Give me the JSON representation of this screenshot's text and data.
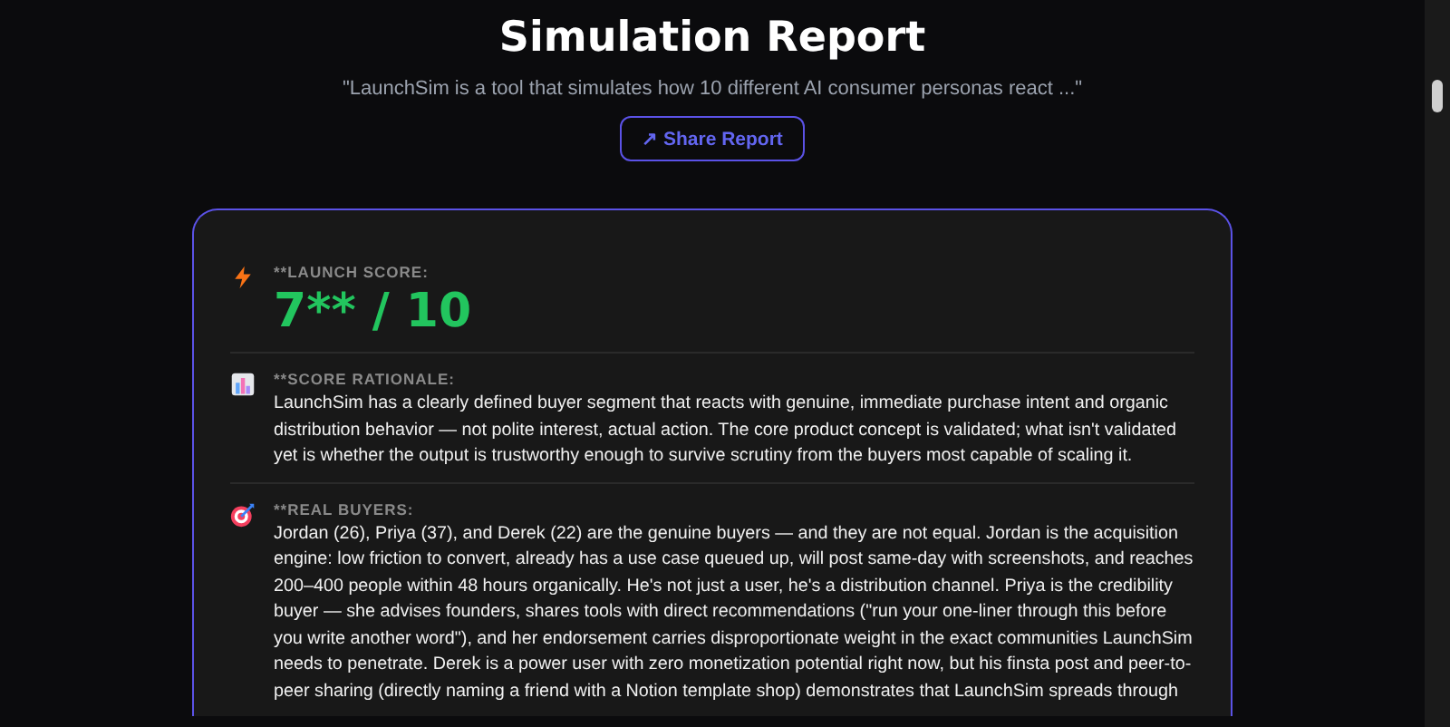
{
  "title": "Simulation Report",
  "summary": "\"LaunchSim is a tool that simulates how 10 different AI consumer personas react ...\"",
  "share_button": {
    "icon": "↗",
    "label": "Share Report"
  },
  "sections": [
    {
      "kind": "score",
      "label": "**LAUNCH SCORE:",
      "value": "7** / 10"
    },
    {
      "kind": "text",
      "label": "**SCORE RATIONALE:",
      "value": "LaunchSim has a clearly defined buyer segment that reacts with genuine, immediate purchase intent and organic distribution behavior — not polite interest, actual action. The core product concept is validated; what isn't validated yet is whether the output is trustworthy enough to survive scrutiny from the buyers most capable of scaling it."
    },
    {
      "kind": "text",
      "label": "**REAL BUYERS:",
      "value": "Jordan (26), Priya (37), and Derek (22) are the genuine buyers — and they are not equal. Jordan is the acquisition engine: low friction to convert, already has a use case queued up, will post same-day with screenshots, and reaches 200–400 people within 48 hours organically. He's not just a user, he's a distribution channel. Priya is the credibility buyer — she advises founders, shares tools with direct recommendations (\"run your one-liner through this before you write another word\"), and her endorsement carries disproportionate weight in the exact communities LaunchSim needs to penetrate. Derek is a power user with zero monetization potential right now, but his finsta post and peer-to-peer sharing (directly naming a friend with a Notion template shop) demonstrates that LaunchSim spreads through"
    }
  ]
}
